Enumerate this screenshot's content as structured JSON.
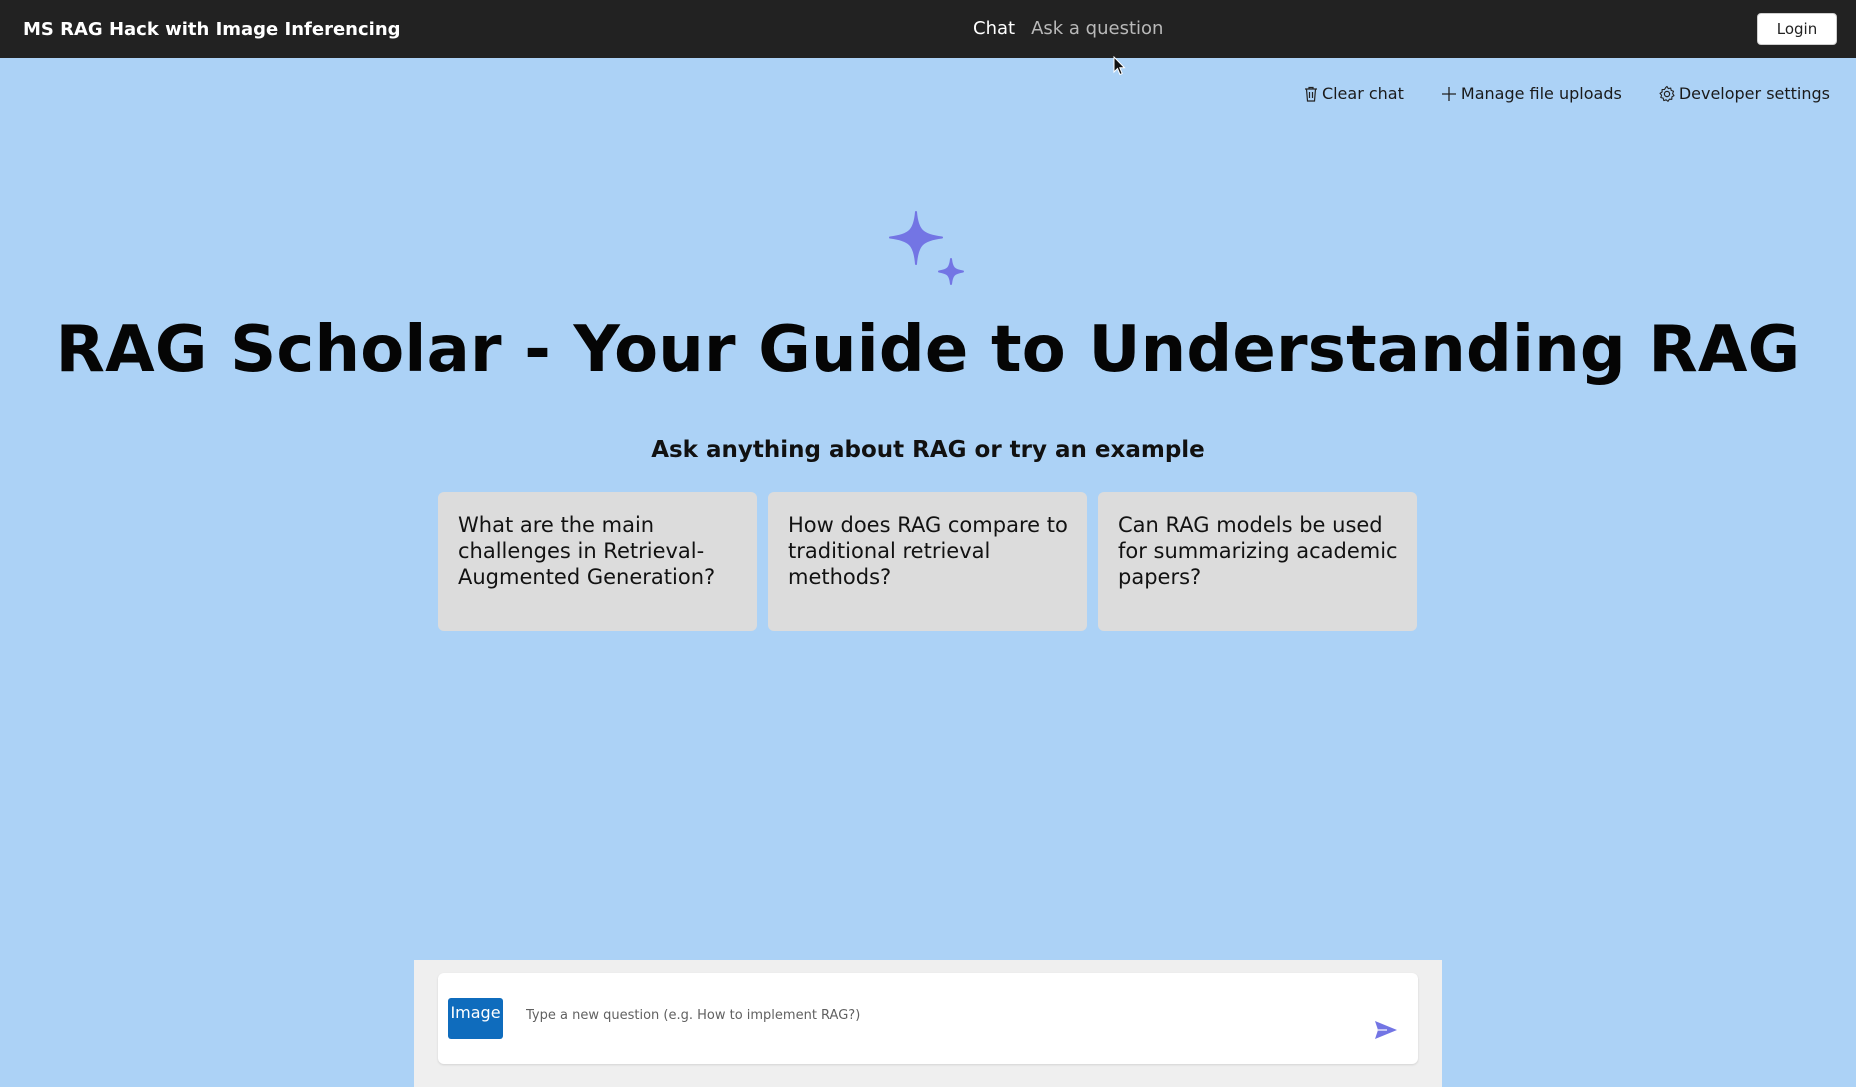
{
  "header": {
    "app_title": "MS RAG Hack with Image Inferencing",
    "nav": {
      "chat": "Chat",
      "ask": "Ask a question"
    },
    "login_label": "Login"
  },
  "toolbar": {
    "clear_chat": "Clear chat",
    "manage_uploads": "Manage file uploads",
    "developer_settings": "Developer settings"
  },
  "main": {
    "title": "RAG Scholar - Your Guide to Understanding RAG",
    "subtitle": "Ask anything about RAG or try an example",
    "examples": [
      "What are the main challenges in Retrieval-Augmented Generation?",
      "How does RAG compare to traditional retrieval methods?",
      "Can RAG models be used for summarizing academic papers?"
    ]
  },
  "composer": {
    "image_label": "Image",
    "placeholder": "Type a new question (e.g. How to implement RAG?)",
    "value": ""
  },
  "icons": {
    "clear": "trash-icon",
    "upload": "plus-icon",
    "settings": "gear-icon",
    "sparkle": "sparkle-icon",
    "send": "send-icon"
  },
  "colors": {
    "background": "#acd2f6",
    "header": "#222222",
    "accent": "#7375e4",
    "image_button": "#0f6cbd",
    "card": "#dcdcdc"
  }
}
